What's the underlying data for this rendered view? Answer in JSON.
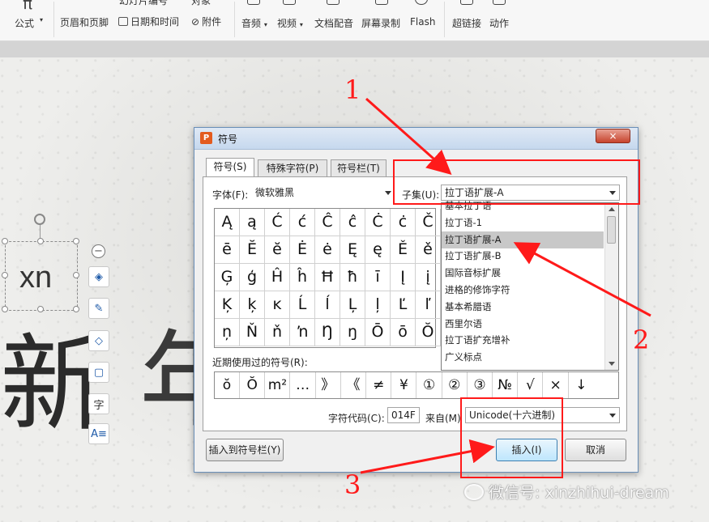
{
  "ribbon": {
    "formula": "公式",
    "slide_number": "幻灯片编号",
    "object": "对象",
    "header_footer": "页眉和页脚",
    "date_time": "日期和时间",
    "attachment": "附件",
    "audio": "音频",
    "video": "视频",
    "doc_voiceover": "文档配音",
    "screen_record": "屏幕录制",
    "flash": "Flash",
    "hyperlink": "超链接",
    "action": "动作"
  },
  "slide": {
    "textbox": "xn",
    "big_chars": [
      "新",
      "年"
    ]
  },
  "float_tools": [
    "minus-icon",
    "layers-icon",
    "pen-icon",
    "fill-icon",
    "border-icon",
    "字",
    "text-icon"
  ],
  "dialog": {
    "title": "符号",
    "close": "×",
    "tabs": [
      "符号(S)",
      "特殊字符(P)",
      "符号栏(T)"
    ],
    "font_label": "字体(F):",
    "font_value": "微软雅黑",
    "subset_label": "子集(U):",
    "subset_value": "拉丁语扩展-A",
    "symbols": [
      [
        "Ą",
        "ą",
        "Ć",
        "ć",
        "Ĉ",
        "ĉ",
        "Ċ",
        "ċ",
        "Č"
      ],
      [
        "ē",
        "Ĕ",
        "ĕ",
        "Ė",
        "ė",
        "Ę",
        "ę",
        "Ě",
        "ě"
      ],
      [
        "Ģ",
        "ģ",
        "Ĥ",
        "ĥ",
        "Ħ",
        "ħ",
        "ī",
        "Į",
        "į"
      ],
      [
        "Ķ",
        "ķ",
        "ĸ",
        "Ĺ",
        "ĺ",
        "Ļ",
        "ļ",
        "Ľ",
        "ľ"
      ],
      [
        "ņ",
        "Ň",
        "ň",
        "ŉ",
        "Ŋ",
        "ŋ",
        "Ō",
        "ō",
        "Ŏ"
      ]
    ],
    "subset_list": [
      "基本拉丁语",
      "拉丁语-1",
      "拉丁语扩展-A",
      "拉丁语扩展-B",
      "国际音标扩展",
      "进格的修饰字符",
      "基本希腊语",
      "西里尔语",
      "拉丁语扩充增补",
      "广义标点"
    ],
    "subset_selected_index": 2,
    "recent_label": "近期使用过的符号(R):",
    "recent_symbols": [
      "ŏ",
      "Ŏ",
      "m²",
      "…",
      "》",
      "《",
      "≠",
      "¥",
      "①",
      "②",
      "③",
      "№",
      "√",
      "×",
      "↓"
    ],
    "char_code_label": "字符代码(C):",
    "char_code_value": "014F",
    "from_label": "来自(M)",
    "from_value": "Unicode(十六进制)",
    "insert_to_bar": "插入到符号栏(Y)",
    "insert": "插入(I)",
    "cancel": "取消"
  },
  "annotations": {
    "numbers": [
      "1",
      "2",
      "3"
    ],
    "color": "#ff1a1a"
  },
  "watermark": "微信号: xinzhihui-dream"
}
